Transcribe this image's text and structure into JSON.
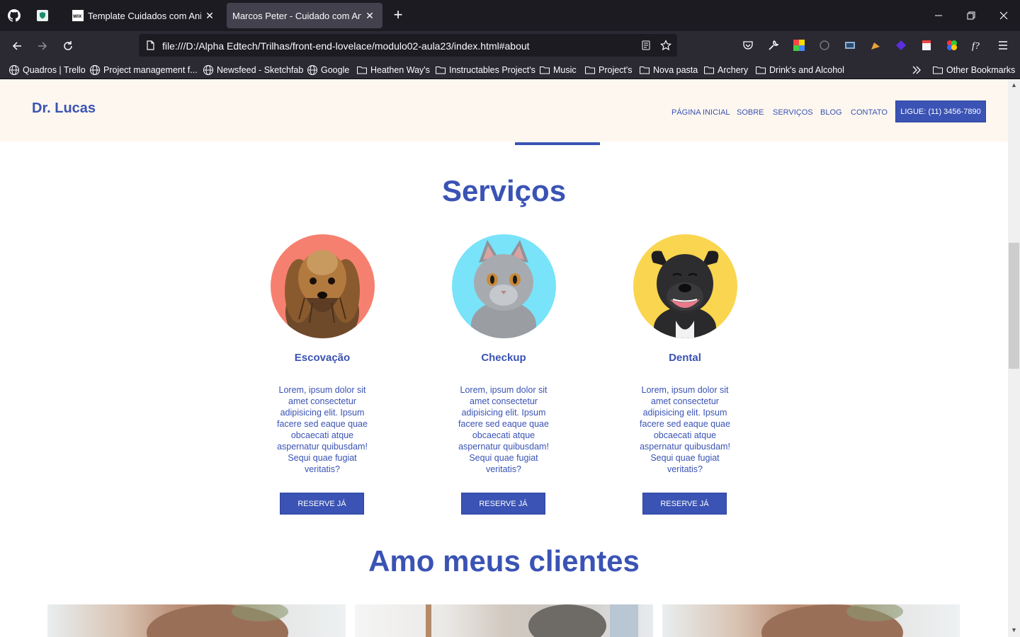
{
  "browser": {
    "tabs": [
      {
        "title": "Template Cuidados com Anima",
        "active": false
      },
      {
        "title": "Marcos Peter - Cuidado com Anima",
        "active": true
      }
    ],
    "url": "file:///D:/Alpha Edtech/Trilhas/front-end-lovelace/modulo02-aula23/index.html#about",
    "bookmarks": [
      {
        "label": "Quadros | Trello",
        "icon": "globe-icon"
      },
      {
        "label": "Project management f...",
        "icon": "globe-icon"
      },
      {
        "label": "Newsfeed - Sketchfab",
        "icon": "globe-icon"
      },
      {
        "label": "Google",
        "icon": "globe-icon"
      },
      {
        "label": "Heathen Way's",
        "icon": "folder-icon"
      },
      {
        "label": "Instructables Project's",
        "icon": "folder-icon"
      },
      {
        "label": "Music",
        "icon": "folder-icon"
      },
      {
        "label": "Project's",
        "icon": "folder-icon"
      },
      {
        "label": "Nova pasta",
        "icon": "folder-icon"
      },
      {
        "label": "Archery",
        "icon": "folder-icon"
      },
      {
        "label": "Drink's and Alcohol",
        "icon": "folder-icon"
      }
    ],
    "other_bookmarks": "Other Bookmarks"
  },
  "site": {
    "logo": "Dr. Lucas",
    "menu": [
      "PÁGINA INICIAL",
      "SOBRE",
      "SERVIÇOS",
      "BLOG",
      "CONTATO"
    ],
    "cta": "LIGUE: (11) 3456-7890",
    "services_title": "Serviços",
    "services": [
      {
        "name": "Escovação",
        "description": "Lorem, ipsum dolor sit amet consectetur adipisicing elit. Ipsum facere sed eaque quae obcaecati atque aspernatur quibusdam! Sequi quae fugiat veritatis?",
        "button": "RESERVE JÁ",
        "bg": "#f6806f"
      },
      {
        "name": "Checkup",
        "description": "Lorem, ipsum dolor sit amet consectetur adipisicing elit. Ipsum facere sed eaque quae obcaecati atque aspernatur quibusdam! Sequi quae fugiat veritatis?",
        "button": "RESERVE JÁ",
        "bg": "#78e3f9"
      },
      {
        "name": "Dental",
        "description": "Lorem, ipsum dolor sit amet consectetur adipisicing elit. Ipsum facere sed eaque quae obcaecati atque aspernatur quibusdam! Sequi quae fugiat veritatis?",
        "button": "RESERVE JÁ",
        "bg": "#fad54f"
      }
    ],
    "clients_title": "Amo meus clientes"
  },
  "colors": {
    "brand": "#3a53b4",
    "header_bg": "#fdf7ef",
    "chrome_dark": "#1c1b22",
    "chrome_mid": "#2b2a33"
  }
}
